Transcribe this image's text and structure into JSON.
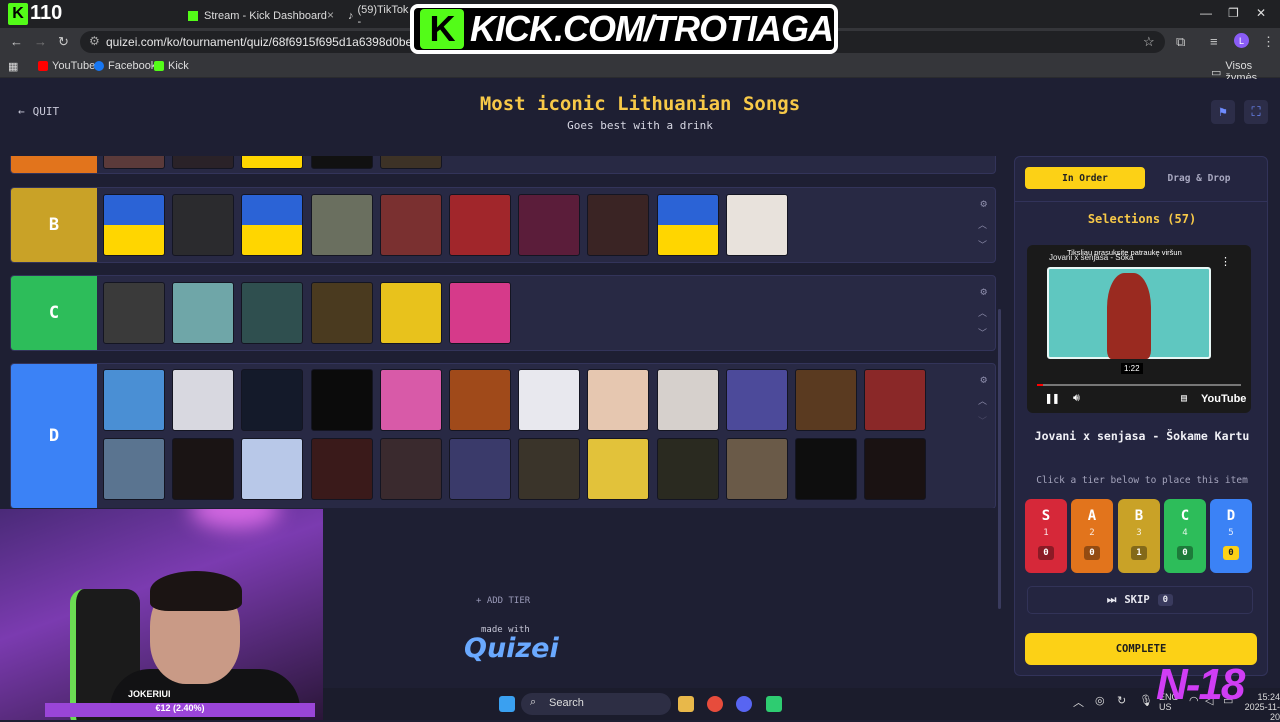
{
  "browser": {
    "viewer_count": "110",
    "tabs": [
      {
        "label": "Stream - Kick Dashboard"
      },
      {
        "label": "(59)TikTok -"
      }
    ],
    "url": "quizei.com/ko/tournament/quiz/68f6915f695d1a6398d0be03/play-on-stre",
    "bookmarks": [
      "YouTube",
      "Facebook",
      "Kick"
    ],
    "all_bookmarks": "Visos žymės",
    "profile_letter": "L"
  },
  "overlay": {
    "banner_text": "KICK.COM/TROTIAGA",
    "n18": "N-18"
  },
  "header": {
    "quit_label": "QUIT",
    "title": "Most iconic Lithuanian Songs",
    "subtitle": "Goes best with a drink"
  },
  "tiers": [
    {
      "label": "B",
      "color": "#c9a227",
      "items": 10
    },
    {
      "label": "C",
      "color": "#2dbd5a",
      "items": 6
    },
    {
      "label": "D",
      "color": "#3b82f6",
      "items": 24
    }
  ],
  "board": {
    "add_tier": "ADD TIER",
    "made_with": "made with",
    "brand": "Quizei"
  },
  "panel": {
    "mode_in_order": "In Order",
    "mode_drag_drop": "Drag & Drop",
    "selections": "Selections (57)",
    "video_overlay_text": "Tiksliau prasuksite patraukę viršun",
    "video_title_text": "Jovani x senjasa - Šoka",
    "video_time": "1:22",
    "video_brand": "YouTube",
    "song_title": "Jovani x senjasa - Šokame Kartu",
    "hint": "Click a tier below to place this item",
    "tier_buttons": [
      {
        "label": "S",
        "key": "1",
        "count": "0",
        "color": "#d62839"
      },
      {
        "label": "A",
        "key": "2",
        "count": "0",
        "color": "#e2741c"
      },
      {
        "label": "B",
        "key": "3",
        "count": "1",
        "color": "#c9a227"
      },
      {
        "label": "C",
        "key": "4",
        "count": "0",
        "color": "#2dbd5a"
      },
      {
        "label": "D",
        "key": "5",
        "count": "0",
        "color": "#3b82f6"
      }
    ],
    "skip_label": "SKIP",
    "skip_count": "0",
    "complete_label": "COMPLETE"
  },
  "webcam": {
    "name": "JOKERIUI",
    "bar_text": "€12 (2.40%)"
  },
  "taskbar": {
    "search_placeholder": "Search",
    "lang": "ENG",
    "region": "US",
    "time": "15:24",
    "date": "2025-11-20"
  }
}
